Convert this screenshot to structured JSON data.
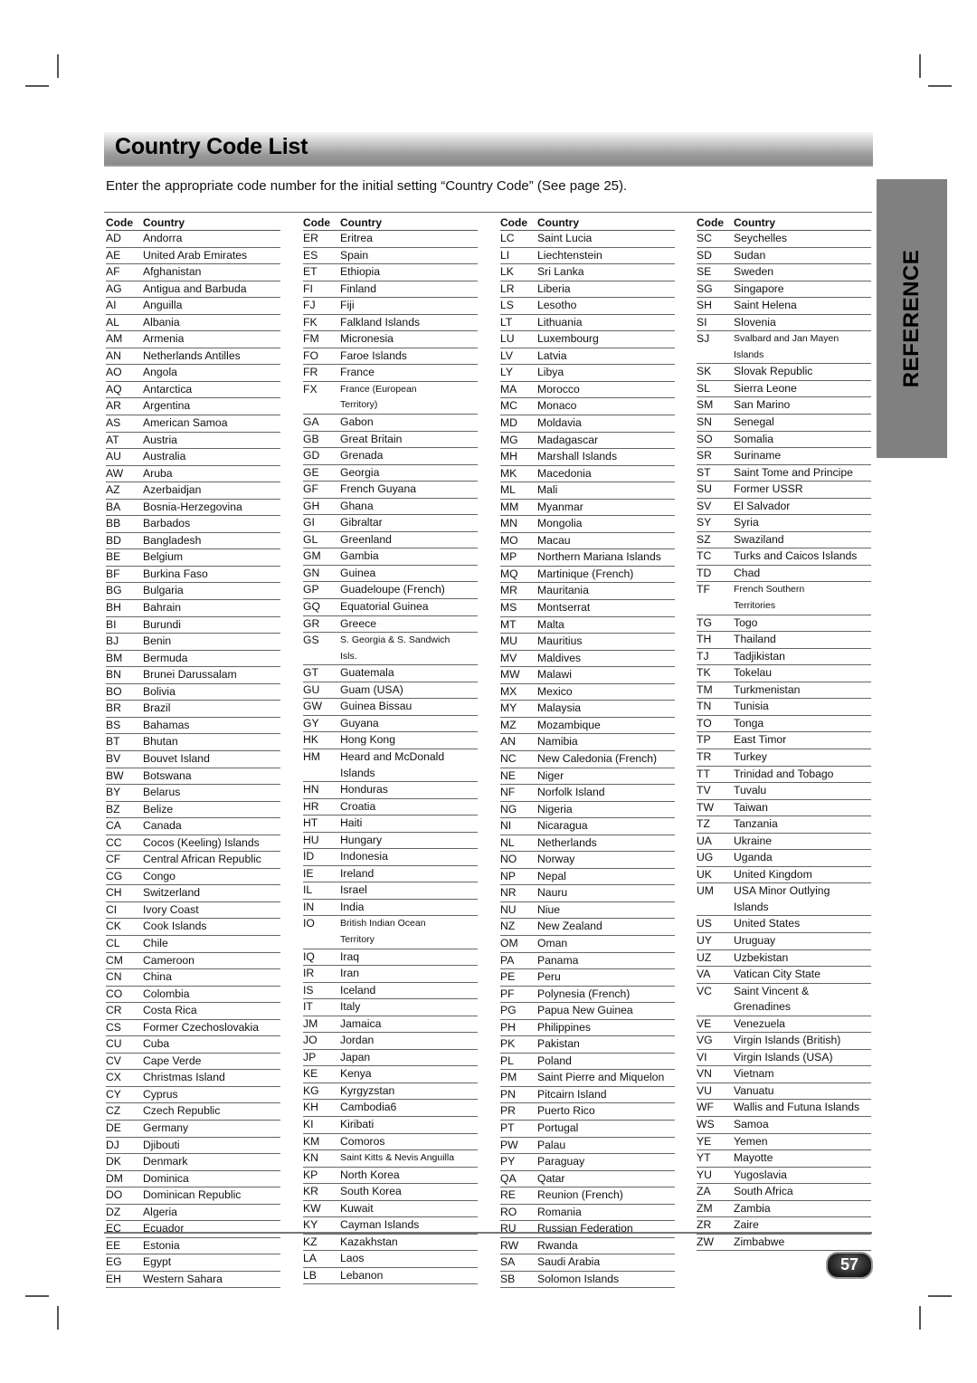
{
  "page": {
    "title": "Country Code List",
    "intro": "Enter the appropriate code number for the initial setting “Country Code” (See page 25).",
    "section_tab": "REFERENCE",
    "page_number": "57"
  },
  "table_headers": {
    "code": "Code",
    "country": "Country"
  },
  "columns": [
    [
      [
        "AD",
        "Andorra"
      ],
      [
        "AE",
        "United Arab Emirates"
      ],
      [
        "AF",
        "Afghanistan"
      ],
      [
        "AG",
        "Antigua and Barbuda"
      ],
      [
        "AI",
        "Anguilla"
      ],
      [
        "AL",
        "Albania"
      ],
      [
        "AM",
        "Armenia"
      ],
      [
        "AN",
        "Netherlands Antilles"
      ],
      [
        "AO",
        "Angola"
      ],
      [
        "AQ",
        "Antarctica"
      ],
      [
        "AR",
        "Argentina"
      ],
      [
        "AS",
        "American Samoa"
      ],
      [
        "AT",
        "Austria"
      ],
      [
        "AU",
        "Australia"
      ],
      [
        "AW",
        "Aruba"
      ],
      [
        "AZ",
        "Azerbaidjan"
      ],
      [
        "BA",
        "Bosnia-Herzegovina"
      ],
      [
        "BB",
        "Barbados"
      ],
      [
        "BD",
        "Bangladesh"
      ],
      [
        "BE",
        "Belgium"
      ],
      [
        "BF",
        "Burkina Faso"
      ],
      [
        "BG",
        "Bulgaria"
      ],
      [
        "BH",
        "Bahrain"
      ],
      [
        "BI",
        "Burundi"
      ],
      [
        "BJ",
        "Benin"
      ],
      [
        "BM",
        "Bermuda"
      ],
      [
        "BN",
        "Brunei Darussalam"
      ],
      [
        "BO",
        "Bolivia"
      ],
      [
        "BR",
        "Brazil"
      ],
      [
        "BS",
        "Bahamas"
      ],
      [
        "BT",
        "Bhutan"
      ],
      [
        "BV",
        "Bouvet Island"
      ],
      [
        "BW",
        "Botswana"
      ],
      [
        "BY",
        "Belarus"
      ],
      [
        "BZ",
        "Belize"
      ],
      [
        "CA",
        "Canada"
      ],
      [
        "CC",
        "Cocos (Keeling) Islands"
      ],
      [
        "CF",
        "Central African Republic"
      ],
      [
        "CG",
        "Congo"
      ],
      [
        "CH",
        "Switzerland"
      ],
      [
        "CI",
        "Ivory Coast"
      ],
      [
        "CK",
        "Cook Islands"
      ],
      [
        "CL",
        "Chile"
      ],
      [
        "CM",
        "Cameroon"
      ],
      [
        "CN",
        "China"
      ],
      [
        "CO",
        "Colombia"
      ],
      [
        "CR",
        "Costa Rica"
      ],
      [
        "CS",
        "Former Czechoslovakia"
      ],
      [
        "CU",
        "Cuba"
      ],
      [
        "CV",
        "Cape Verde"
      ],
      [
        "CX",
        "Christmas Island"
      ],
      [
        "CY",
        "Cyprus"
      ],
      [
        "CZ",
        "Czech Republic"
      ],
      [
        "DE",
        "Germany"
      ],
      [
        "DJ",
        "Djibouti"
      ],
      [
        "DK",
        "Denmark"
      ],
      [
        "DM",
        "Dominica"
      ],
      [
        "DO",
        "Dominican Republic"
      ],
      [
        "DZ",
        "Algeria"
      ],
      [
        "EC",
        "Ecuador"
      ],
      [
        "EE",
        "Estonia"
      ],
      [
        "EG",
        "Egypt"
      ],
      [
        "EH",
        "Western Sahara"
      ]
    ],
    [
      [
        "ER",
        "Eritrea"
      ],
      [
        "ES",
        "Spain"
      ],
      [
        "ET",
        "Ethiopia"
      ],
      [
        "FI",
        "Finland"
      ],
      [
        "FJ",
        "Fiji"
      ],
      [
        "FK",
        "Falkland Islands"
      ],
      [
        "FM",
        "Micronesia"
      ],
      [
        "FO",
        "Faroe Islands"
      ],
      [
        "FR",
        "France"
      ],
      [
        "FX",
        "France (European|Territory)"
      ],
      [
        "GA",
        "Gabon"
      ],
      [
        "GB",
        "Great Britain"
      ],
      [
        "GD",
        "Grenada"
      ],
      [
        "GE",
        "Georgia"
      ],
      [
        "GF",
        "French Guyana"
      ],
      [
        "GH",
        "Ghana"
      ],
      [
        "GI",
        "Gibraltar"
      ],
      [
        "GL",
        "Greenland"
      ],
      [
        "GM",
        "Gambia"
      ],
      [
        "GN",
        "Guinea"
      ],
      [
        "GP",
        "Guadeloupe (French)"
      ],
      [
        "GQ",
        "Equatorial Guinea"
      ],
      [
        "GR",
        "Greece"
      ],
      [
        "GS",
        "S. Georgia & S. Sandwich|Isls."
      ],
      [
        "GT",
        "Guatemala"
      ],
      [
        "GU",
        "Guam (USA)"
      ],
      [
        "GW",
        "Guinea Bissau"
      ],
      [
        "GY",
        "Guyana"
      ],
      [
        "HK",
        "Hong Kong"
      ],
      [
        "HM",
        "Heard and McDonald|Islands"
      ],
      [
        "HN",
        "Honduras"
      ],
      [
        "HR",
        "Croatia"
      ],
      [
        "HT",
        "Haiti"
      ],
      [
        "HU",
        "Hungary"
      ],
      [
        "ID",
        "Indonesia"
      ],
      [
        "IE",
        "Ireland"
      ],
      [
        "IL",
        "Israel"
      ],
      [
        "IN",
        "India"
      ],
      [
        "IO",
        "British Indian Ocean|Territory"
      ],
      [
        "IQ",
        "Iraq"
      ],
      [
        "IR",
        "Iran"
      ],
      [
        "IS",
        "Iceland"
      ],
      [
        "IT",
        "Italy"
      ],
      [
        "JM",
        "Jamaica"
      ],
      [
        "JO",
        "Jordan"
      ],
      [
        "JP",
        "Japan"
      ],
      [
        "KE",
        "Kenya"
      ],
      [
        "KG",
        "Kyrgyzstan"
      ],
      [
        "KH",
        "Cambodia6"
      ],
      [
        "KI",
        "Kiribati"
      ],
      [
        "KM",
        "Comoros"
      ],
      [
        "KN",
        "Saint Kitts & Nevis Anguilla"
      ],
      [
        "KP",
        "North Korea"
      ],
      [
        "KR",
        "South Korea"
      ],
      [
        "KW",
        "Kuwait"
      ],
      [
        "KY",
        "Cayman Islands"
      ],
      [
        "KZ",
        "Kazakhstan"
      ],
      [
        "LA",
        "Laos"
      ],
      [
        "LB",
        "Lebanon"
      ]
    ],
    [
      [
        "LC",
        "Saint Lucia"
      ],
      [
        "LI",
        "Liechtenstein"
      ],
      [
        "LK",
        "Sri Lanka"
      ],
      [
        "LR",
        "Liberia"
      ],
      [
        "LS",
        "Lesotho"
      ],
      [
        "LT",
        "Lithuania"
      ],
      [
        "LU",
        "Luxembourg"
      ],
      [
        "LV",
        "Latvia"
      ],
      [
        "LY",
        "Libya"
      ],
      [
        "MA",
        "Morocco"
      ],
      [
        "MC",
        "Monaco"
      ],
      [
        "MD",
        "Moldavia"
      ],
      [
        "MG",
        "Madagascar"
      ],
      [
        "MH",
        "Marshall Islands"
      ],
      [
        "MK",
        "Macedonia"
      ],
      [
        "ML",
        "Mali"
      ],
      [
        "MM",
        "Myanmar"
      ],
      [
        "MN",
        "Mongolia"
      ],
      [
        "MO",
        "Macau"
      ],
      [
        "MP",
        "Northern Mariana Islands"
      ],
      [
        "MQ",
        "Martinique (French)"
      ],
      [
        "MR",
        "Mauritania"
      ],
      [
        "MS",
        "Montserrat"
      ],
      [
        "MT",
        "Malta"
      ],
      [
        "MU",
        "Mauritius"
      ],
      [
        "MV",
        "Maldives"
      ],
      [
        "MW",
        "Malawi"
      ],
      [
        "MX",
        "Mexico"
      ],
      [
        "MY",
        "Malaysia"
      ],
      [
        "MZ",
        "Mozambique"
      ],
      [
        "AN",
        "Namibia"
      ],
      [
        "NC",
        "New Caledonia (French)"
      ],
      [
        "NE",
        "Niger"
      ],
      [
        "NF",
        "Norfolk Island"
      ],
      [
        "NG",
        "Nigeria"
      ],
      [
        "NI",
        "Nicaragua"
      ],
      [
        "NL",
        "Netherlands"
      ],
      [
        "NO",
        "Norway"
      ],
      [
        "NP",
        "Nepal"
      ],
      [
        "NR",
        "Nauru"
      ],
      [
        "NU",
        "Niue"
      ],
      [
        "NZ",
        "New Zealand"
      ],
      [
        "OM",
        "Oman"
      ],
      [
        "PA",
        "Panama"
      ],
      [
        "PE",
        "Peru"
      ],
      [
        "PF",
        "Polynesia (French)"
      ],
      [
        "PG",
        "Papua New Guinea"
      ],
      [
        "PH",
        "Philippines"
      ],
      [
        "PK",
        "Pakistan"
      ],
      [
        "PL",
        "Poland"
      ],
      [
        "PM",
        "Saint Pierre and Miquelon"
      ],
      [
        "PN",
        "Pitcairn Island"
      ],
      [
        "PR",
        "Puerto Rico"
      ],
      [
        "PT",
        "Portugal"
      ],
      [
        "PW",
        "Palau"
      ],
      [
        "PY",
        "Paraguay"
      ],
      [
        "QA",
        "Qatar"
      ],
      [
        "RE",
        "Reunion (French)"
      ],
      [
        "RO",
        "Romania"
      ],
      [
        "RU",
        "Russian Federation"
      ],
      [
        "RW",
        "Rwanda"
      ],
      [
        "SA",
        "Saudi Arabia"
      ],
      [
        "SB",
        "Solomon Islands"
      ]
    ],
    [
      [
        "SC",
        "Seychelles"
      ],
      [
        "SD",
        "Sudan"
      ],
      [
        "SE",
        "Sweden"
      ],
      [
        "SG",
        "Singapore"
      ],
      [
        "SH",
        "Saint Helena"
      ],
      [
        "SI",
        "Slovenia"
      ],
      [
        "SJ",
        "Svalbard and Jan Mayen|Islands"
      ],
      [
        "SK",
        "Slovak Republic"
      ],
      [
        "SL",
        "Sierra Leone"
      ],
      [
        "SM",
        "San Marino"
      ],
      [
        "SN",
        "Senegal"
      ],
      [
        "SO",
        "Somalia"
      ],
      [
        "SR",
        "Suriname"
      ],
      [
        "ST",
        "Saint Tome and Principe"
      ],
      [
        "SU",
        "Former USSR"
      ],
      [
        "SV",
        "El Salvador"
      ],
      [
        "SY",
        "Syria"
      ],
      [
        "SZ",
        "Swaziland"
      ],
      [
        "TC",
        "Turks and Caicos Islands"
      ],
      [
        "TD",
        "Chad"
      ],
      [
        "TF",
        "French Southern|Territories"
      ],
      [
        "TG",
        "Togo"
      ],
      [
        "TH",
        "Thailand"
      ],
      [
        "TJ",
        "Tadjikistan"
      ],
      [
        "TK",
        "Tokelau"
      ],
      [
        "TM",
        "Turkmenistan"
      ],
      [
        "TN",
        "Tunisia"
      ],
      [
        "TO",
        "Tonga"
      ],
      [
        "TP",
        "East Timor"
      ],
      [
        "TR",
        "Turkey"
      ],
      [
        "TT",
        "Trinidad and Tobago"
      ],
      [
        "TV",
        "Tuvalu"
      ],
      [
        "TW",
        "Taiwan"
      ],
      [
        "TZ",
        "Tanzania"
      ],
      [
        "UA",
        "Ukraine"
      ],
      [
        "UG",
        "Uganda"
      ],
      [
        "UK",
        "United Kingdom"
      ],
      [
        "UM",
        "USA Minor Outlying|Islands"
      ],
      [
        "US",
        "United States"
      ],
      [
        "UY",
        "Uruguay"
      ],
      [
        "UZ",
        "Uzbekistan"
      ],
      [
        "VA",
        "Vatican City State"
      ],
      [
        "VC",
        "Saint Vincent &|Grenadines"
      ],
      [
        "VE",
        "Venezuela"
      ],
      [
        "VG",
        "Virgin Islands (British)"
      ],
      [
        "VI",
        "Virgin Islands (USA)"
      ],
      [
        "VN",
        "Vietnam"
      ],
      [
        "VU",
        "Vanuatu"
      ],
      [
        "WF",
        "Wallis and Futuna Islands"
      ],
      [
        "WS",
        "Samoa"
      ],
      [
        "YE",
        "Yemen"
      ],
      [
        "YT",
        "Mayotte"
      ],
      [
        "YU",
        "Yugoslavia"
      ],
      [
        "ZA",
        "South Africa"
      ],
      [
        "ZM",
        "Zambia"
      ],
      [
        "ZR",
        "Zaire"
      ],
      [
        "ZW",
        "Zimbabwe"
      ]
    ]
  ]
}
